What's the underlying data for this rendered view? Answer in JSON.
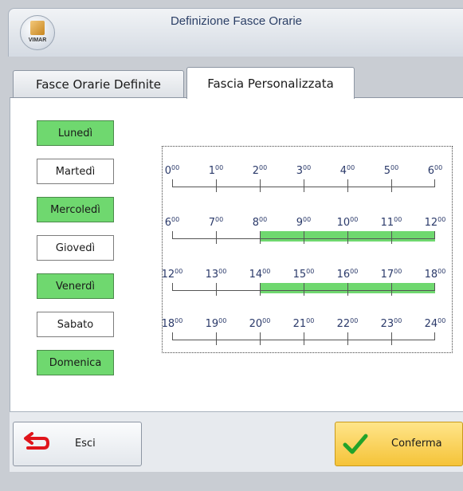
{
  "window": {
    "title": "Definizione Fasce Orarie",
    "logo_text": "VIMAR"
  },
  "tabs": [
    {
      "label": "Fasce Orarie Definite",
      "active": false
    },
    {
      "label": "Fascia Personalizzata",
      "active": true
    }
  ],
  "days": [
    {
      "label": "Lunedì",
      "selected": true
    },
    {
      "label": "Martedì",
      "selected": false
    },
    {
      "label": "Mercoledì",
      "selected": true
    },
    {
      "label": "Giovedì",
      "selected": false
    },
    {
      "label": "Venerdì",
      "selected": true
    },
    {
      "label": "Sabato",
      "selected": false
    },
    {
      "label": "Domenica",
      "selected": true
    }
  ],
  "schedule": {
    "rows": [
      {
        "hours": [
          "0",
          "1",
          "2",
          "3",
          "4",
          "5",
          "6"
        ],
        "active_from": null,
        "active_to": null
      },
      {
        "hours": [
          "6",
          "7",
          "8",
          "9",
          "10",
          "11",
          "12"
        ],
        "active_from": "8",
        "active_to": "12"
      },
      {
        "hours": [
          "12",
          "13",
          "14",
          "15",
          "16",
          "17",
          "18"
        ],
        "active_from": "14",
        "active_to": "18"
      },
      {
        "hours": [
          "18",
          "19",
          "20",
          "21",
          "22",
          "23",
          "24"
        ],
        "active_from": null,
        "active_to": null
      }
    ],
    "minutes_suffix": "00",
    "active_color": "#6fd86f"
  },
  "footer": {
    "exit_label": "Esci",
    "exit_icon": "undo-arrow-icon",
    "confirm_label": "Conferma",
    "confirm_icon": "checkmark-icon"
  }
}
